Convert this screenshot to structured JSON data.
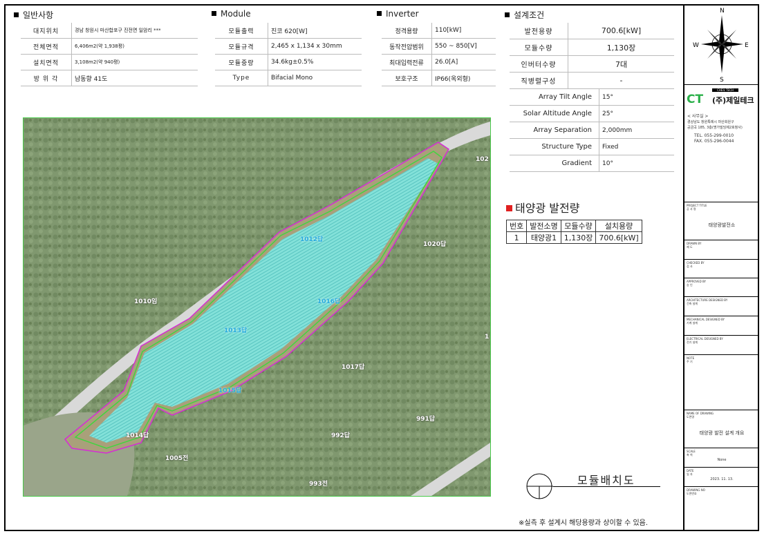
{
  "general": {
    "title": "일반사항",
    "rows": [
      {
        "label": "대지위치",
        "value": "경남 창원시 마산합포구 진전면 일암리 ***"
      },
      {
        "label": "전체면적",
        "value": "6,406m2(약 1,938평)"
      },
      {
        "label": "설치면적",
        "value": "3,108m2(약 940평)"
      },
      {
        "label": "방 위 각",
        "value": "남동향 41도"
      }
    ]
  },
  "module": {
    "title": "Module",
    "rows": [
      {
        "label": "모듈출력",
        "value": "진코 620[W]"
      },
      {
        "label": "모듈규격",
        "value": "2,465 x 1,134 x 30mm"
      },
      {
        "label": "모듈중량",
        "value": "34.6kg±0.5%"
      },
      {
        "label": "Type",
        "value": "Bifacial Mono"
      }
    ]
  },
  "inverter": {
    "title": "Inverter",
    "rows": [
      {
        "label": "정격용량",
        "value": "110[kW]"
      },
      {
        "label": "동작전압범위",
        "value": "550 ~ 850[V]"
      },
      {
        "label": "최대입력전류",
        "value": "26.0[A]"
      },
      {
        "label": "보호구조",
        "value": "IP66(옥외형)"
      }
    ]
  },
  "design": {
    "title": "설계조건",
    "rows": [
      {
        "label": "발전용량",
        "value": "700.6[kW]"
      },
      {
        "label": "모듈수량",
        "value": "1,130장"
      },
      {
        "label": "인버터수량",
        "value": "7대"
      },
      {
        "label": "직병렬구성",
        "value": "-"
      }
    ],
    "rows2": [
      {
        "label": "Array Tilt Angle",
        "value": "15°"
      },
      {
        "label": "Solar Altitude Angle",
        "value": "25°"
      },
      {
        "label": "Array Separation",
        "value": "2,000mm"
      },
      {
        "label": "Structure Type",
        "value": "Fixed"
      },
      {
        "label": "Gradient",
        "value": "10°"
      }
    ]
  },
  "map": {
    "labels": [
      "1012답",
      "1020답",
      "1010임",
      "1016답",
      "1013답",
      "1017답",
      "1015답",
      "991답",
      "1014답",
      "992답",
      "1005전",
      "993전",
      "102",
      "1"
    ]
  },
  "power": {
    "title": "태양광 발전량",
    "headers": [
      "번호",
      "발전소명",
      "모듈수량",
      "설치용량"
    ],
    "row": [
      "1",
      "태양광1",
      "1,130장",
      "700.6[kW]"
    ]
  },
  "layout_title": "모듈배치도",
  "note": "※실측 후 설계시 해당용량과 상이할 수 있음.",
  "compass": {
    "n": "N",
    "s": "S",
    "e": "E",
    "w": "W"
  },
  "company": {
    "badge": "CHEIL TECH",
    "logo_letters": "CT",
    "name": "(주)제일테크",
    "office_label": "< 사무실 >",
    "address1": "경상남도 창원특례시 마산회원구",
    "address2": "공금곡 185, 3층(명가빌딩제2호청사)",
    "tel": "TEL. 055-299-0010",
    "fax": "FAX. 055-296-0044"
  },
  "title_block": {
    "project_label": "PROJECT TITLE\n공 사 명",
    "project_value": "태양광발전소",
    "drawn_label": "DRAWN BY\n제 도",
    "checked_label": "CHECKED BY\n검 사",
    "approved_label": "APPROVED BY\n승 인",
    "arch_label": "ARCHITECTURE DESIGNED BY\n건축 설계",
    "mech_label": "MECHANICAL DESIGNED BY\n기계 설계",
    "elec_label": "ELECTRICAL DESIGNED BY\n전기 설계",
    "note_label": "NOTE\n주 기",
    "drawing_name_label": "NAME OF DRAWING\n도면명",
    "drawing_name_value": "태양광 발전 설계 개요",
    "scale_label": "SCALE\n축 척",
    "scale_value": "None",
    "date_label": "DATE\n일 자",
    "date_value": "2023. 11. 13.",
    "drawing_no_label": "DRAWING NO\n도면번호"
  }
}
